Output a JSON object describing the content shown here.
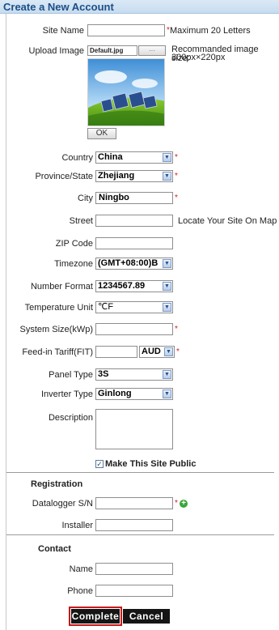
{
  "header": {
    "title": "Create a New Account"
  },
  "site_name": {
    "label": "Site Name",
    "value": "",
    "required_mark": "*",
    "hint": "Maximum 20 Letters"
  },
  "upload_image": {
    "label": "Upload Image",
    "file_value": "Default.jpg",
    "browse_label": "···",
    "hint_line1": "Recommanded image size:",
    "hint_line2": "300px×220px",
    "ok_label": "OK",
    "preview_icon": "solar-panel-field-image"
  },
  "country": {
    "label": "Country",
    "value": "China",
    "required_mark": "*"
  },
  "province": {
    "label": "Province/State",
    "value": "Zhejiang",
    "required_mark": "*"
  },
  "city": {
    "label": "City",
    "value": "Ningbo",
    "required_mark": "*"
  },
  "street": {
    "label": "Street",
    "value": "",
    "link": "Locate Your Site On Map"
  },
  "zip": {
    "label": "ZIP Code",
    "value": ""
  },
  "timezone": {
    "label": "Timezone",
    "value": "(GMT+08:00)B"
  },
  "number_format": {
    "label": "Number Format",
    "value": "1234567.89"
  },
  "temperature_unit": {
    "label": "Temperature Unit",
    "value": "℃F"
  },
  "system_size": {
    "label": "System Size(kWp)",
    "value": "",
    "required_mark": "*"
  },
  "feed_in_tariff": {
    "label": "Feed-in Tariff(FIT)",
    "value": "",
    "currency": "AUD",
    "required_mark": "*"
  },
  "panel_type": {
    "label": "Panel Type",
    "value": "3S"
  },
  "inverter_type": {
    "label": "Inverter Type",
    "value": "Ginlong"
  },
  "description": {
    "label": "Description",
    "value": ""
  },
  "public_checkbox": {
    "label": "Make This Site Public",
    "checked": true
  },
  "registration": {
    "title": "Registration",
    "datalogger": {
      "label": "Datalogger S/N",
      "value": "",
      "required_mark": "*"
    },
    "installer": {
      "label": "Installer",
      "value": ""
    }
  },
  "contact": {
    "title": "Contact",
    "name": {
      "label": "Name",
      "value": ""
    },
    "phone": {
      "label": "Phone",
      "value": ""
    }
  },
  "actions": {
    "complete_label": "Complete",
    "cancel_label": "Cancel"
  },
  "colors": {
    "header_bg": "#c6dcf0",
    "header_text": "#1d4f86",
    "required": "#d21c1c",
    "button_bg": "#151515",
    "complete_outline": "#c41a1a"
  }
}
